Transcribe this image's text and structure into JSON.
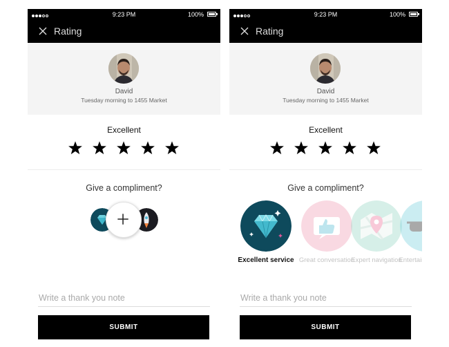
{
  "status_bar": {
    "time": "9:23 PM",
    "battery": "100%"
  },
  "nav": {
    "title": "Rating"
  },
  "driver": {
    "name": "David",
    "trip": "Tuesday morning to 1455 Market"
  },
  "rating": {
    "label": "Excellent",
    "stars": 5,
    "max_stars": 5
  },
  "compliment": {
    "prompt": "Give a compliment?",
    "badges": [
      {
        "label": "Excellent service",
        "icon": "diamond-icon",
        "color": "#0e4a5c",
        "selected": true
      },
      {
        "label": "Great conversation",
        "icon": "thumbs-up-icon",
        "color": "#f3a9bd",
        "selected": false
      },
      {
        "label": "Expert navigation",
        "icon": "map-pin-icon",
        "color": "#9bd8c6",
        "selected": false
      },
      {
        "label": "Entertaining driver",
        "icon": "sunglasses-icon",
        "color": "#7fd3df",
        "selected": false
      }
    ]
  },
  "note": {
    "placeholder": "Write a thank you note"
  },
  "submit": {
    "label": "SUBMIT"
  },
  "colors": {
    "bar": "#000000",
    "panel": "#f4f4f4",
    "button": "#000000"
  }
}
